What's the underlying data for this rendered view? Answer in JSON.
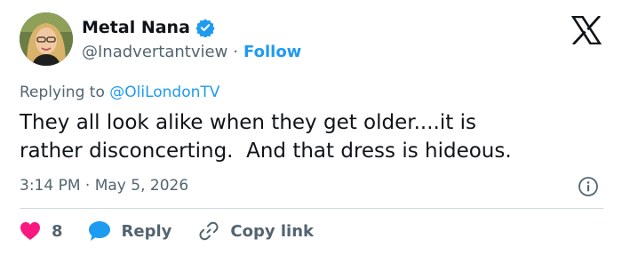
{
  "tweet": {
    "author": {
      "display_name": "Metal Nana",
      "handle": "@Inadvertantview",
      "separator": "·",
      "follow_label": "Follow",
      "verified_icon": "verified-badge-icon",
      "avatar": "avatar-photo"
    },
    "platform_logo": "x-logo-icon",
    "replying_prefix": "Replying to",
    "replying_to": "@OliLondonTV",
    "text": "They all look alike when they get older....it is\nrather disconcerting.  And that dress is hideous.",
    "timestamp": "3:14 PM · May 5, 2026",
    "info_icon": "info-icon",
    "actions": {
      "like_count": "8",
      "like_icon": "heart-icon",
      "reply_label": "Reply",
      "reply_icon": "speech-bubble-icon",
      "copy_label": "Copy link",
      "copy_icon": "link-icon"
    }
  },
  "colors": {
    "accent": "#1d9bf0",
    "text": "#0f1419",
    "muted": "#536471",
    "like": "#f91880",
    "divider": "#cfd9de"
  }
}
